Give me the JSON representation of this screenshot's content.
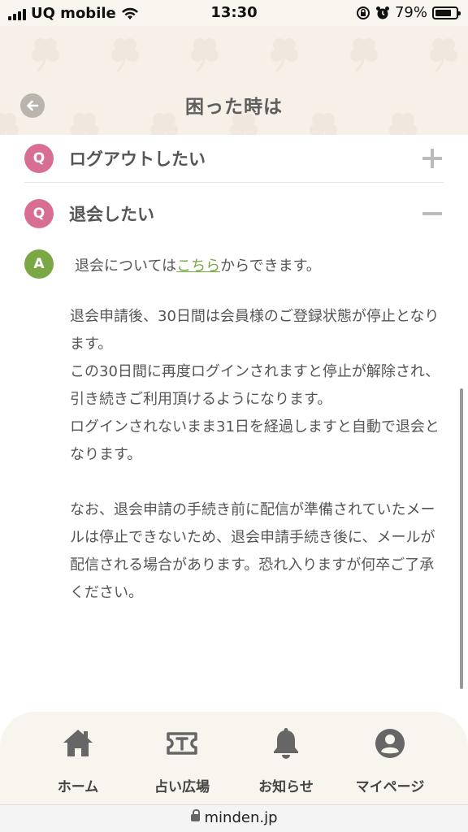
{
  "status_bar": {
    "carrier": "UQ mobile",
    "time": "13:30",
    "battery": "79%",
    "battery_level": 0.79
  },
  "header": {
    "title": "困った時は"
  },
  "faq": {
    "items": [
      {
        "badge": "Q",
        "question": "ログアウトしたい",
        "expanded": false
      },
      {
        "badge": "Q",
        "question": "退会したい",
        "expanded": true
      }
    ],
    "answer": {
      "badge": "A",
      "lead_before": "退会については",
      "lead_link": "こちら",
      "lead_after": "からできます。",
      "paragraphs": [
        "退会申請後、30日間は会員様のご登録状態が停止となります。\nこの30日間に再度ログインされますと停止が解除され、引き続きご利用頂けるようになります。\nログインされないまま31日を経過しますと自動で退会となります。",
        "なお、退会申請の手続き前に配信が準備されていたメールは停止できないため、退会申請手続き後に、メールが配信される場合があります。恐れ入りますが何卒ご了承ください。"
      ]
    }
  },
  "tabbar": {
    "tabs": [
      {
        "label": "ホーム",
        "icon": "home-icon"
      },
      {
        "label": "占い広場",
        "icon": "ticket-icon"
      },
      {
        "label": "お知らせ",
        "icon": "bell-icon"
      },
      {
        "label": "マイページ",
        "icon": "user-circle-icon"
      }
    ]
  },
  "browser": {
    "url": "minden.jp"
  },
  "colors": {
    "q_badge": "#d96e94",
    "a_badge": "#79a845",
    "header_bg": "#f6f0e9"
  }
}
